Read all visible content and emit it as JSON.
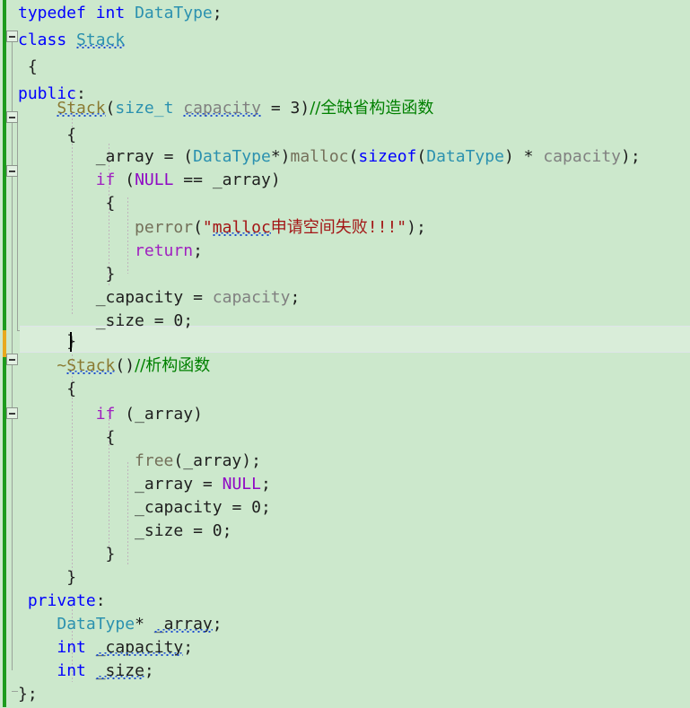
{
  "editor": {
    "language": "C++",
    "background_color": "#cce8cc",
    "current_line_color": "#d9edd9",
    "change_bar_color": "#1d9b1d",
    "change_bar_unsaved_color": "#e8a91e",
    "font_size_px": 18,
    "line_height_px": 30,
    "cursor_line_index": 12,
    "cursor_column": 6
  },
  "colors": {
    "keyword": "#0000ff",
    "control_keyword": "#a020c0",
    "type": "#2b91af",
    "macro": "#8f08c4",
    "function": "#74705a",
    "constructor": "#8a7a32",
    "parameter": "#808080",
    "string": "#a31515",
    "comment": "#008000",
    "identifier": "#1e1e1e",
    "squiggle": "#2050d0"
  },
  "gutter": {
    "fold_boxes": [
      {
        "name": "fold-class-stack",
        "line_index": 1
      },
      {
        "name": "fold-ctor-stack",
        "line_index": 4
      },
      {
        "name": "fold-if-null-array",
        "line_index": 6
      },
      {
        "name": "fold-dtor-stack",
        "line_index": 13
      },
      {
        "name": "fold-if-array",
        "line_index": 15
      }
    ],
    "fold_icon": "minus-square-icon"
  },
  "code": {
    "lines": [
      {
        "index": 0,
        "indent": 1,
        "text": "typedef int DataType;"
      },
      {
        "index": 1,
        "indent": 0,
        "text": "class Stack"
      },
      {
        "index": 2,
        "indent": 0,
        "text": "{"
      },
      {
        "index": 3,
        "indent": 0,
        "text": "public:"
      },
      {
        "index": 4,
        "indent": 2,
        "text": "Stack(size_t capacity = 3)//全缺省构造函数"
      },
      {
        "index": 5,
        "indent": 2,
        "text": "{"
      },
      {
        "index": 6,
        "indent": 3,
        "text": "_array = (DataType*)malloc(sizeof(DataType) * capacity);"
      },
      {
        "index": 7,
        "indent": 3,
        "text": "if (NULL == _array)"
      },
      {
        "index": 8,
        "indent": 3,
        "text": "{"
      },
      {
        "index": 9,
        "indent": 4,
        "text": "perror(\"malloc申请空间失败!!!\");"
      },
      {
        "index": 10,
        "indent": 4,
        "text": "return;"
      },
      {
        "index": 11,
        "indent": 3,
        "text": "}"
      },
      {
        "index": 12,
        "indent": 3,
        "text": "_capacity = capacity;"
      },
      {
        "index": 13,
        "indent": 3,
        "text": "_size = 0;"
      },
      {
        "index": 14,
        "indent": 2,
        "text": "}"
      },
      {
        "index": 15,
        "indent": 2,
        "text": "~Stack()//析构函数"
      },
      {
        "index": 16,
        "indent": 2,
        "text": "{"
      },
      {
        "index": 17,
        "indent": 3,
        "text": "if (_array)"
      },
      {
        "index": 18,
        "indent": 3,
        "text": "{"
      },
      {
        "index": 19,
        "indent": 4,
        "text": "free(_array);"
      },
      {
        "index": 20,
        "indent": 4,
        "text": "_array = NULL;"
      },
      {
        "index": 21,
        "indent": 4,
        "text": "_capacity = 0;"
      },
      {
        "index": 22,
        "indent": 4,
        "text": "_size = 0;"
      },
      {
        "index": 23,
        "indent": 3,
        "text": "}"
      },
      {
        "index": 24,
        "indent": 2,
        "text": "}"
      },
      {
        "index": 25,
        "indent": 0,
        "text": "private:"
      },
      {
        "index": 26,
        "indent": 2,
        "text": "DataType* _array;"
      },
      {
        "index": 27,
        "indent": 2,
        "text": "int _capacity;"
      },
      {
        "index": 28,
        "indent": 2,
        "text": "int _size;"
      },
      {
        "index": 29,
        "indent": 0,
        "text": "};"
      }
    ],
    "comments": {
      "ctor_comment": "//全缺省构造函数",
      "dtor_comment": "//析构函数"
    },
    "strings": {
      "malloc_error": "\"malloc申请空间失败!!!\""
    },
    "identifiers_with_squiggle": [
      "Stack",
      "capacity",
      "malloc",
      "_array",
      "_capacity",
      "_size"
    ]
  }
}
